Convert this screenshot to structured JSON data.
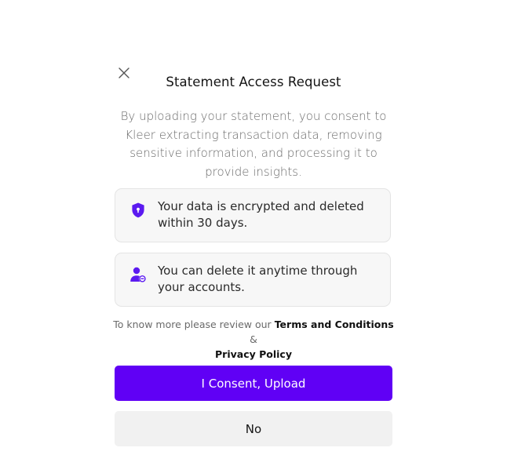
{
  "dialog": {
    "title": "Statement Access Request",
    "intro": "By uploading your statement, you consent to Kleer extracting transaction data, removing sensitive information, and processing it to provide insights.",
    "close_icon": "close-icon"
  },
  "info_items": [
    {
      "icon": "shield-lock-icon",
      "text": "Your data is encrypted and deleted within 30 days."
    },
    {
      "icon": "user-remove-icon",
      "text": "You can delete it anytime through your accounts."
    }
  ],
  "terms": {
    "prefix": "To know more please review our",
    "terms_link": "Terms and Conditions",
    "connector": "&",
    "privacy_link": "Privacy Policy"
  },
  "actions": {
    "consent_label": "I Consent, Upload",
    "decline_label": "No"
  },
  "colors": {
    "accent": "#6000F5",
    "icon": "#5B1AF0",
    "card_bg": "#F7F7F7",
    "secondary_button_bg": "#F1F1F1"
  }
}
